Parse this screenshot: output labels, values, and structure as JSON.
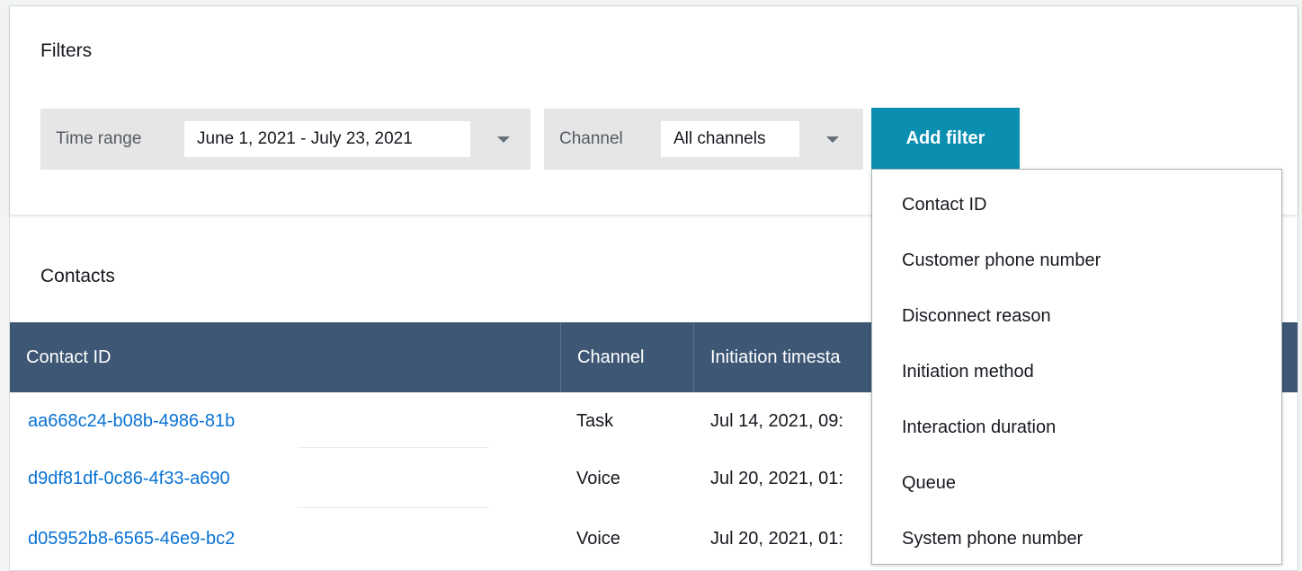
{
  "filters": {
    "title": "Filters",
    "time_range": {
      "label": "Time range",
      "value": "June 1, 2021 - July 23, 2021"
    },
    "channel": {
      "label": "Channel",
      "value": "All channels"
    },
    "add_filter_label": "Add filter",
    "accent_color": "#0b8fb1"
  },
  "add_filter_menu": {
    "items": [
      "Contact ID",
      "Customer phone number",
      "Disconnect reason",
      "Initiation method",
      "Interaction duration",
      "Queue",
      "System phone number"
    ]
  },
  "contacts": {
    "title": "Contacts",
    "header_color": "#3e5775",
    "columns": [
      "Contact ID",
      "Channel",
      "Initiation timesta"
    ],
    "rows": [
      {
        "id": "aa668c24-b08b-4986-81b",
        "channel": "Task",
        "time": "Jul 14, 2021, 09:"
      },
      {
        "id": "d9df81df-0c86-4f33-a690",
        "channel": "Voice",
        "time": "Jul 20, 2021, 01:"
      },
      {
        "id": "d05952b8-6565-46e9-bc2",
        "channel": "Voice",
        "time": "Jul 20, 2021, 01:"
      }
    ]
  }
}
